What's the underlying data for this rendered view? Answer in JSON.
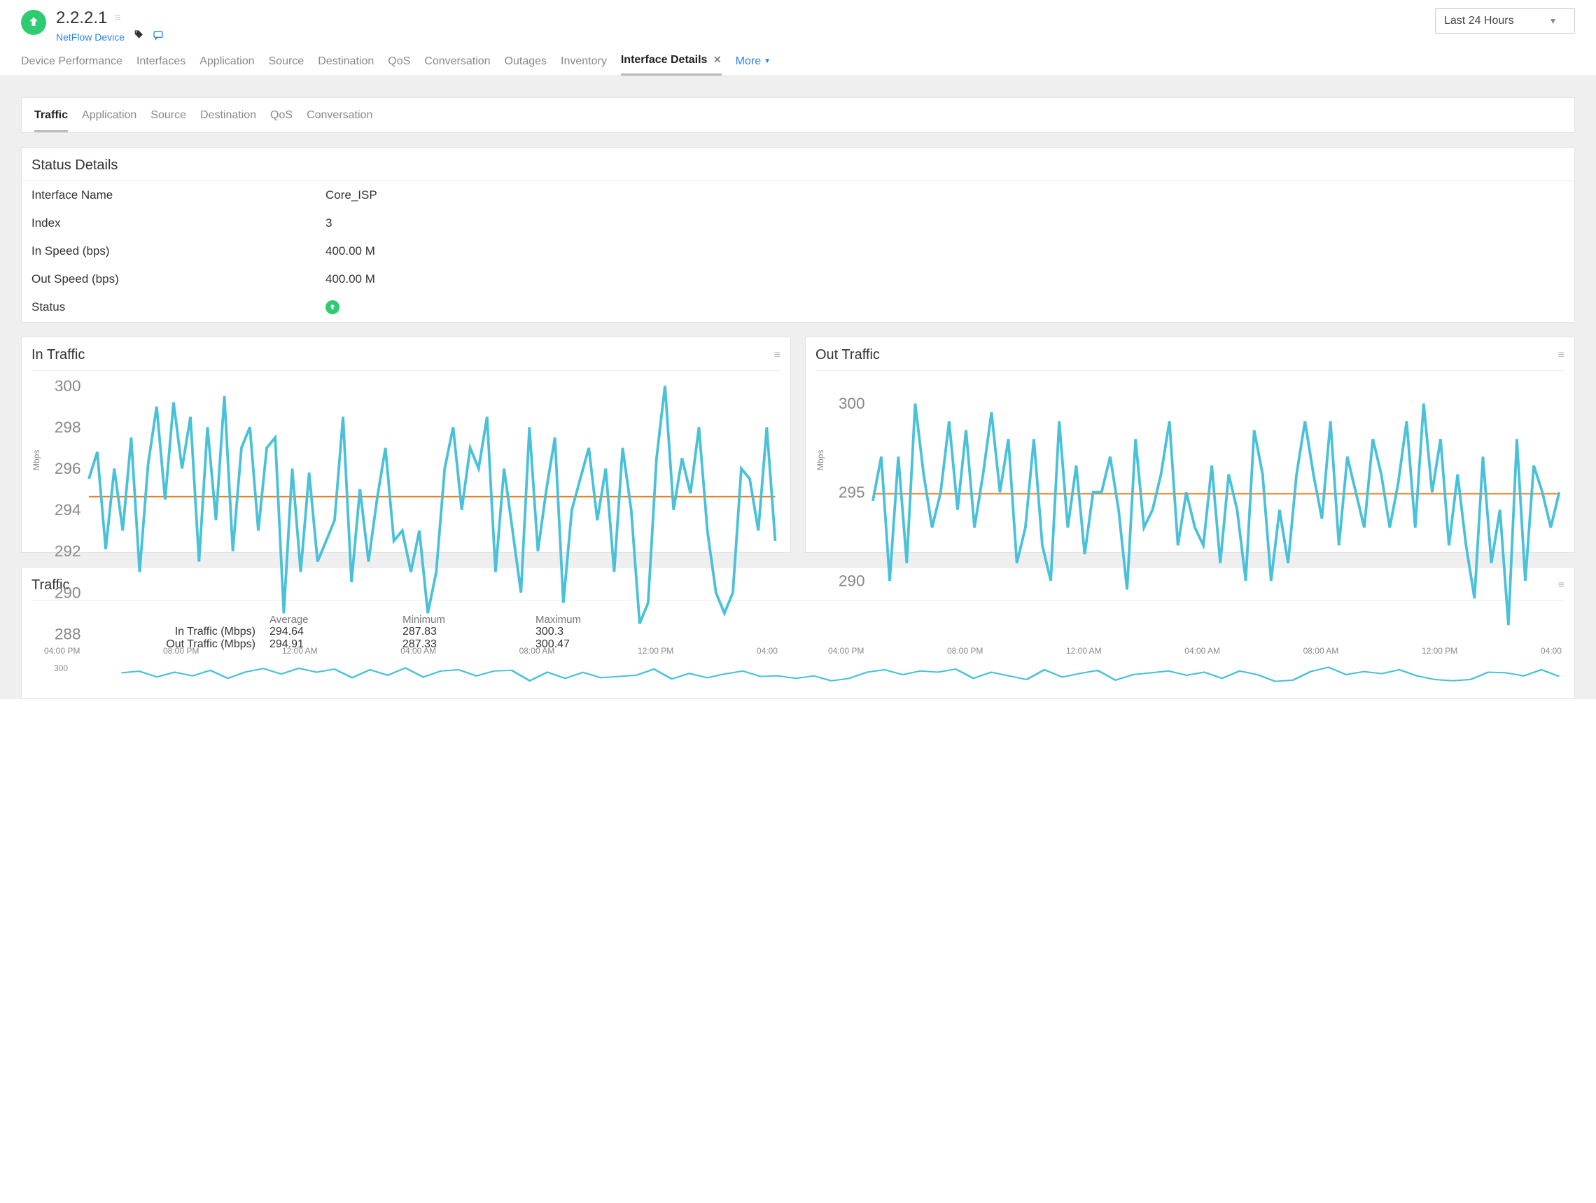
{
  "header": {
    "title": "2.2.2.1",
    "subtitle_link": "NetFlow Device",
    "range_label": "Last 24 Hours"
  },
  "primary_tabs": {
    "items": [
      {
        "label": "Device Performance"
      },
      {
        "label": "Interfaces"
      },
      {
        "label": "Application"
      },
      {
        "label": "Source"
      },
      {
        "label": "Destination"
      },
      {
        "label": "QoS"
      },
      {
        "label": "Conversation"
      },
      {
        "label": "Outages"
      },
      {
        "label": "Inventory"
      },
      {
        "label": "Interface Details",
        "active": true,
        "closable": true
      }
    ],
    "more_label": "More"
  },
  "inner_tabs": {
    "items": [
      {
        "label": "Traffic",
        "active": true
      },
      {
        "label": "Application"
      },
      {
        "label": "Source"
      },
      {
        "label": "Destination"
      },
      {
        "label": "QoS"
      },
      {
        "label": "Conversation"
      }
    ]
  },
  "status_details": {
    "title": "Status Details",
    "rows": {
      "interface_name": {
        "k": "Interface Name",
        "v": "Core_ISP"
      },
      "index": {
        "k": "Index",
        "v": "3"
      },
      "in_speed": {
        "k": "In Speed (bps)",
        "v": "400.00 M"
      },
      "out_speed": {
        "k": "Out Speed (bps)",
        "v": "400.00 M"
      },
      "status": {
        "k": "Status"
      }
    }
  },
  "traffic_summary": {
    "title": "Traffic",
    "cols": {
      "avg": "Average",
      "min": "Minimum",
      "max": "Maximum"
    },
    "rows": [
      {
        "label": "In Traffic (Mbps)",
        "avg": "294.64",
        "min": "287.83",
        "max": "300.3"
      },
      {
        "label": "Out Traffic (Mbps)",
        "avg": "294.91",
        "min": "287.33",
        "max": "300.47"
      }
    ],
    "preview_ytick": "300"
  },
  "chart_data": [
    {
      "type": "line",
      "title": "In Traffic",
      "ylabel": "Mbps",
      "ylim": [
        288,
        300
      ],
      "yticks": [
        288,
        290,
        292,
        294,
        296,
        298,
        300
      ],
      "xticks": [
        "04:00 PM",
        "08:00 PM",
        "12:00 AM",
        "04:00 AM",
        "08:00 AM",
        "12:00 PM",
        "04:00"
      ],
      "average": 294.64,
      "series": [
        {
          "name": "In Traffic",
          "values": [
            295.5,
            296.8,
            292.1,
            296.0,
            293.0,
            297.5,
            291.0,
            296.2,
            299.0,
            294.5,
            299.2,
            296.0,
            298.5,
            291.5,
            298.0,
            293.5,
            299.5,
            292.0,
            297.0,
            298.0,
            293.0,
            297.0,
            297.5,
            289.0,
            296.0,
            291.0,
            295.8,
            291.5,
            292.5,
            293.5,
            298.5,
            290.5,
            295.0,
            291.5,
            294.5,
            297.0,
            292.5,
            293.0,
            291.0,
            293.0,
            289.0,
            291.0,
            296.0,
            298.0,
            294.0,
            297.0,
            296.0,
            298.5,
            291.0,
            296.0,
            293.0,
            290.0,
            298.0,
            292.0,
            295.0,
            297.5,
            289.5,
            294.0,
            295.5,
            297.0,
            293.5,
            296.0,
            291.0,
            297.0,
            294.0,
            288.5,
            289.5,
            296.5,
            300.0,
            294.0,
            296.5,
            294.8,
            298.0,
            293.0,
            290.0,
            289.0,
            290.0,
            296.0,
            295.5,
            293.0,
            298.0,
            292.5
          ]
        }
      ]
    },
    {
      "type": "line",
      "title": "Out Traffic",
      "ylabel": "Mbps",
      "ylim": [
        287,
        301
      ],
      "yticks": [
        290,
        295,
        300
      ],
      "xticks": [
        "04:00 PM",
        "08:00 PM",
        "12:00 AM",
        "04:00 AM",
        "08:00 AM",
        "12:00 PM",
        "04:00"
      ],
      "average": 294.91,
      "series": [
        {
          "name": "Out Traffic",
          "values": [
            294.5,
            297.0,
            290.0,
            297.0,
            291.0,
            300.0,
            296.0,
            293.0,
            295.0,
            299.0,
            294.0,
            298.5,
            293.0,
            296.0,
            299.5,
            295.0,
            298.0,
            291.0,
            293.0,
            298.0,
            292.0,
            290.0,
            299.0,
            293.0,
            296.5,
            291.5,
            295.0,
            295.0,
            297.0,
            294.0,
            289.5,
            298.0,
            293.0,
            294.0,
            296.0,
            299.0,
            292.0,
            295.0,
            293.0,
            292.0,
            296.5,
            291.0,
            296.0,
            294.0,
            290.0,
            298.5,
            296.0,
            290.0,
            294.0,
            291.0,
            296.0,
            299.0,
            296.0,
            293.5,
            299.0,
            292.0,
            297.0,
            295.0,
            293.0,
            298.0,
            296.0,
            293.0,
            295.5,
            299.0,
            293.0,
            300.0,
            295.0,
            298.0,
            292.0,
            296.0,
            292.0,
            289.0,
            297.0,
            291.0,
            294.0,
            287.5,
            298.0,
            290.0,
            296.5,
            295.0,
            293.0,
            295.0
          ]
        }
      ]
    }
  ]
}
